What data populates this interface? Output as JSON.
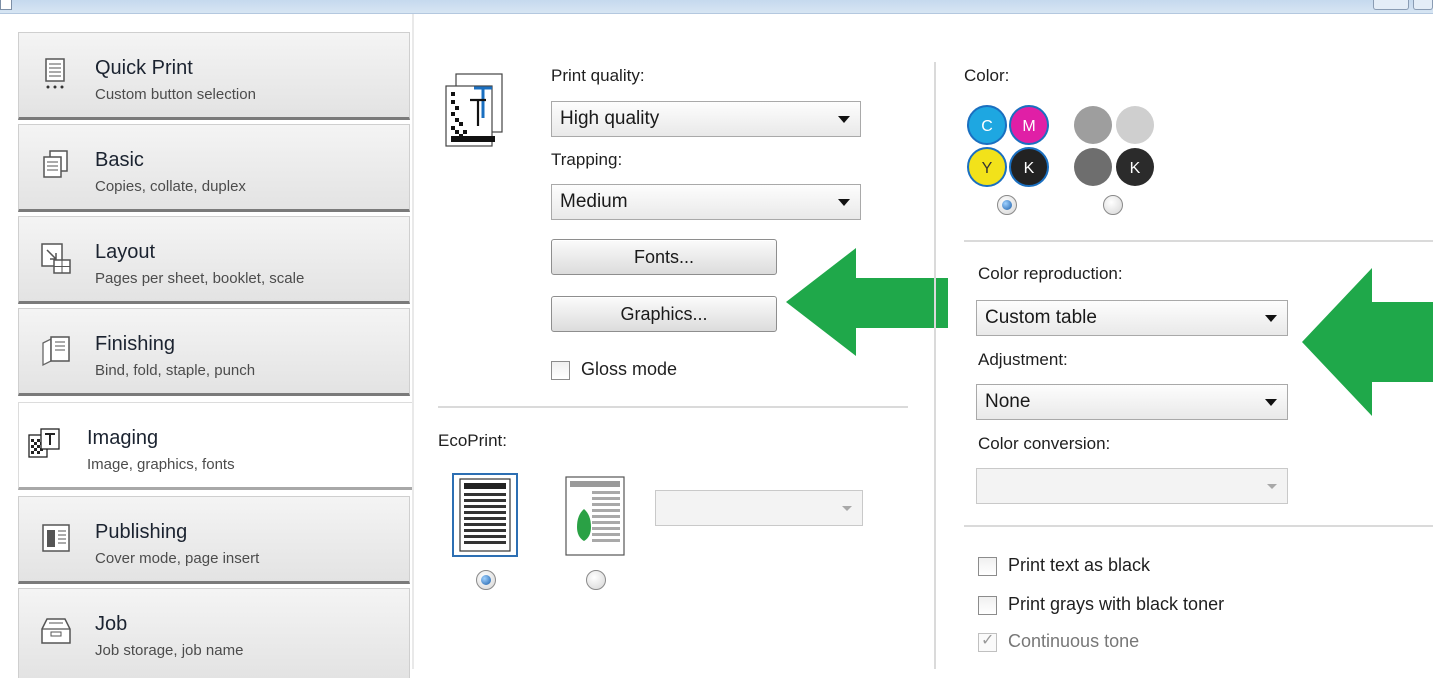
{
  "nav": {
    "items": [
      {
        "title": "Quick Print",
        "subtitle": "Custom button selection",
        "icon": "quick-print-icon"
      },
      {
        "title": "Basic",
        "subtitle": "Copies, collate, duplex",
        "icon": "basic-icon"
      },
      {
        "title": "Layout",
        "subtitle": "Pages per sheet, booklet, scale",
        "icon": "layout-icon"
      },
      {
        "title": "Finishing",
        "subtitle": "Bind, fold, staple, punch",
        "icon": "finishing-icon"
      },
      {
        "title": "Imaging",
        "subtitle": "Image, graphics, fonts",
        "icon": "imaging-icon",
        "active": true
      },
      {
        "title": "Publishing",
        "subtitle": "Cover mode, page insert",
        "icon": "publishing-icon"
      },
      {
        "title": "Job",
        "subtitle": "Job storage, job name",
        "icon": "job-icon"
      }
    ]
  },
  "imaging": {
    "print_quality_label": "Print quality:",
    "print_quality_value": "High quality",
    "trapping_label": "Trapping:",
    "trapping_value": "Medium",
    "fonts_button": "Fonts...",
    "graphics_button": "Graphics...",
    "gloss_mode_label": "Gloss mode",
    "gloss_mode_checked": false,
    "ecoprint_label": "EcoPrint:",
    "ecoprint_selected": "off",
    "ecoprint_select_value": ""
  },
  "color": {
    "label": "Color:",
    "selected": "color",
    "cmyk_letters": [
      "C",
      "M",
      "Y",
      "K"
    ],
    "mono_letter": "K",
    "color_reproduction_label": "Color reproduction:",
    "color_reproduction_value": "Custom table",
    "adjustment_label": "Adjustment:",
    "adjustment_value": "None",
    "color_conversion_label": "Color conversion:",
    "color_conversion_value": "",
    "print_text_black_label": "Print text as black",
    "print_text_black_checked": false,
    "print_grays_label": "Print grays with black toner",
    "print_grays_checked": false,
    "continuous_tone_label": "Continuous tone",
    "continuous_tone_checked": true,
    "continuous_tone_disabled": true
  },
  "colors": {
    "cyan": "#1ea7e1",
    "magenta": "#e01fa6",
    "yellow": "#f2e21a",
    "black": "#222222",
    "ring": "#1a6fc0",
    "annotation_arrow": "#1fa84a"
  }
}
